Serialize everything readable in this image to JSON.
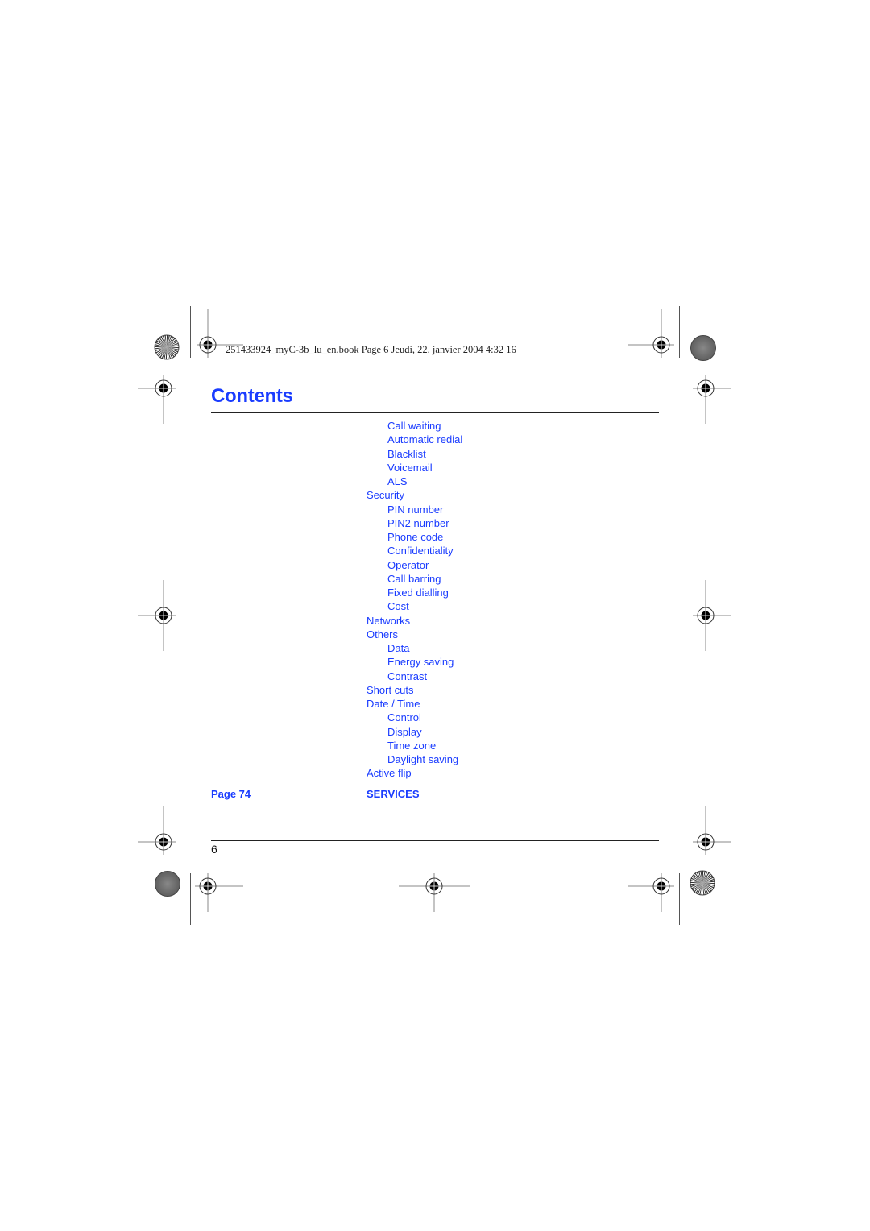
{
  "header": {
    "slug": "251433924_myC-3b_lu_en.book  Page 6  Jeudi, 22. janvier 2004  4:32 16"
  },
  "page": {
    "title": "Contents",
    "accent_color": "#1a3cff",
    "page_number": "6"
  },
  "toc": {
    "items": [
      {
        "label": "Call waiting",
        "level": 2
      },
      {
        "label": "Automatic redial",
        "level": 2
      },
      {
        "label": "Blacklist",
        "level": 2
      },
      {
        "label": "Voicemail",
        "level": 2
      },
      {
        "label": "ALS",
        "level": 2
      },
      {
        "label": "Security",
        "level": 1
      },
      {
        "label": "PIN number",
        "level": 2
      },
      {
        "label": "PIN2 number",
        "level": 2
      },
      {
        "label": "Phone code",
        "level": 2
      },
      {
        "label": "Confidentiality",
        "level": 2
      },
      {
        "label": "Operator",
        "level": 2
      },
      {
        "label": "Call barring",
        "level": 2
      },
      {
        "label": "Fixed dialling",
        "level": 2
      },
      {
        "label": "Cost",
        "level": 2
      },
      {
        "label": "Networks",
        "level": 1
      },
      {
        "label": "Others",
        "level": 1
      },
      {
        "label": "Data",
        "level": 2
      },
      {
        "label": "Energy saving",
        "level": 2
      },
      {
        "label": "Contrast",
        "level": 2
      },
      {
        "label": "Short cuts",
        "level": 1
      },
      {
        "label": "Date / Time",
        "level": 1
      },
      {
        "label": "Control",
        "level": 2
      },
      {
        "label": "Display",
        "level": 2
      },
      {
        "label": "Time zone",
        "level": 2
      },
      {
        "label": "Daylight saving",
        "level": 2
      },
      {
        "label": "Active flip",
        "level": 1
      }
    ],
    "section": {
      "page_label": "Page 74",
      "name": "SERVICES"
    }
  },
  "icons": {
    "registration_mark": "crosshair-target-icon",
    "starburst": "starburst-icon",
    "gray_disc": "gray-disc-icon"
  }
}
